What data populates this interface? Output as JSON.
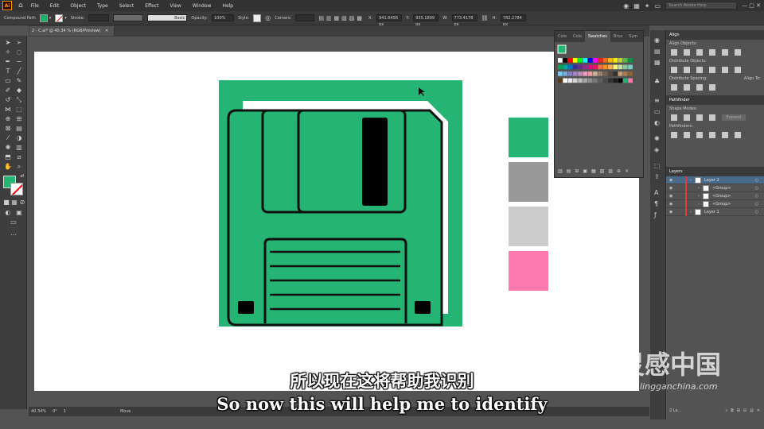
{
  "menubar": {
    "logo": "Ai",
    "items": [
      "File",
      "Edit",
      "Object",
      "Type",
      "Select",
      "Effect",
      "View",
      "Window",
      "Help"
    ],
    "search_placeholder": "Search Adobe Help"
  },
  "controlbar": {
    "selection_label": "Compound Path",
    "stroke_label": "Stroke:",
    "brush_label": "Basic",
    "opacity_label": "Opacity:",
    "opacity_value": "100%",
    "style_label": "Style:",
    "corners_label": "Corners:",
    "x_label": "X:",
    "x_value": "941.6456 px",
    "y_label": "Y:",
    "y_value": "935.1899 px",
    "w_label": "W:",
    "w_value": "773.4178 px",
    "h_label": "H:",
    "h_value": "782.2784 px",
    "fill_color": "#1ead6b"
  },
  "document": {
    "tab_title": "2 - C.ai* @ 40.34 % (RGB/Preview)"
  },
  "statusbar": {
    "zoom": "40.34%",
    "rotation": "0°",
    "artboard": "1",
    "mode": "Move"
  },
  "artwork": {
    "background_color": "#24b473",
    "disk_color": "#24b473",
    "swatches": [
      "#24b473",
      "#999999",
      "#cccccc",
      "#ff7aac"
    ]
  },
  "swatches_panel": {
    "tabs": [
      "Colo",
      "Colo",
      "Swatches",
      "Brus",
      "Sym"
    ],
    "active_tab": "Swatches"
  },
  "align_panel": {
    "title": "Align",
    "align_objects": "Align Objects:",
    "distribute_objects": "Distribute Objects:",
    "distribute_spacing": "Distribute Spacing:",
    "align_to": "Align To:"
  },
  "pathfinder_panel": {
    "title": "Pathfinder",
    "shape_modes": "Shape Modes:",
    "expand": "Expand",
    "pathfinders": "Pathfinders:"
  },
  "layers_panel": {
    "title": "Layers",
    "rows": [
      {
        "name": "Layer 2",
        "selected": true
      },
      {
        "name": "<Group>",
        "selected": false
      },
      {
        "name": "<Group>",
        "selected": false
      },
      {
        "name": "<Group>",
        "selected": false
      },
      {
        "name": "Layer 1",
        "selected": false
      }
    ],
    "footer": "2 La..."
  },
  "subtitles": {
    "chinese": "所以现在这将帮助我识别",
    "english": "So now this will help me to identify"
  },
  "watermark": {
    "brand": "灵感中国",
    "url": "lingganchina.com"
  }
}
